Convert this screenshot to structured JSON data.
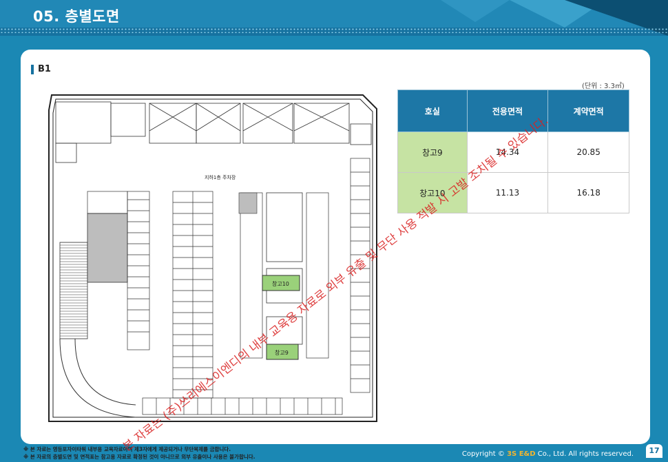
{
  "header": {
    "title": "05. 층별도면"
  },
  "section": {
    "label": "B1"
  },
  "unit_note": "(단위 : 3.3㎡)",
  "table": {
    "headers": [
      "호실",
      "전용면적",
      "계약면적"
    ],
    "rows": [
      {
        "room": "창고9",
        "exclusive": "14.34",
        "contract": "20.85"
      },
      {
        "room": "창고10",
        "exclusive": "11.13",
        "contract": "16.18"
      }
    ]
  },
  "plan": {
    "parking_label": "지하1층 주차장",
    "storage9": "창고9",
    "storage10": "창고10"
  },
  "footnotes": [
    "※ 본 자료는 영등포자이타워 내부용 교육자료이며 제3자에게 제공되거나 무단복제를 금합니다.",
    "※ 본 자료의 층별도면 및 면적표는 참고용 자료로 확정된 것이 아니므로 외부 유출이나 사용은 불가합니다."
  ],
  "footer": {
    "copyright_prefix": "Copyright ©",
    "brand": "3S E&D",
    "copyright_suffix": "Co., Ltd. All rights reserved.",
    "page": "17"
  },
  "watermark": "본 자료는 (주)쓰리에스이엔디의 내부 교육용 자료로 외부 유출 및 무단 사용 적발 시 고발 조치될 수 있습니다.",
  "colors": {
    "accent": "#1672a0",
    "highlight": "#c6e3a3",
    "watermark": "#d92020"
  }
}
